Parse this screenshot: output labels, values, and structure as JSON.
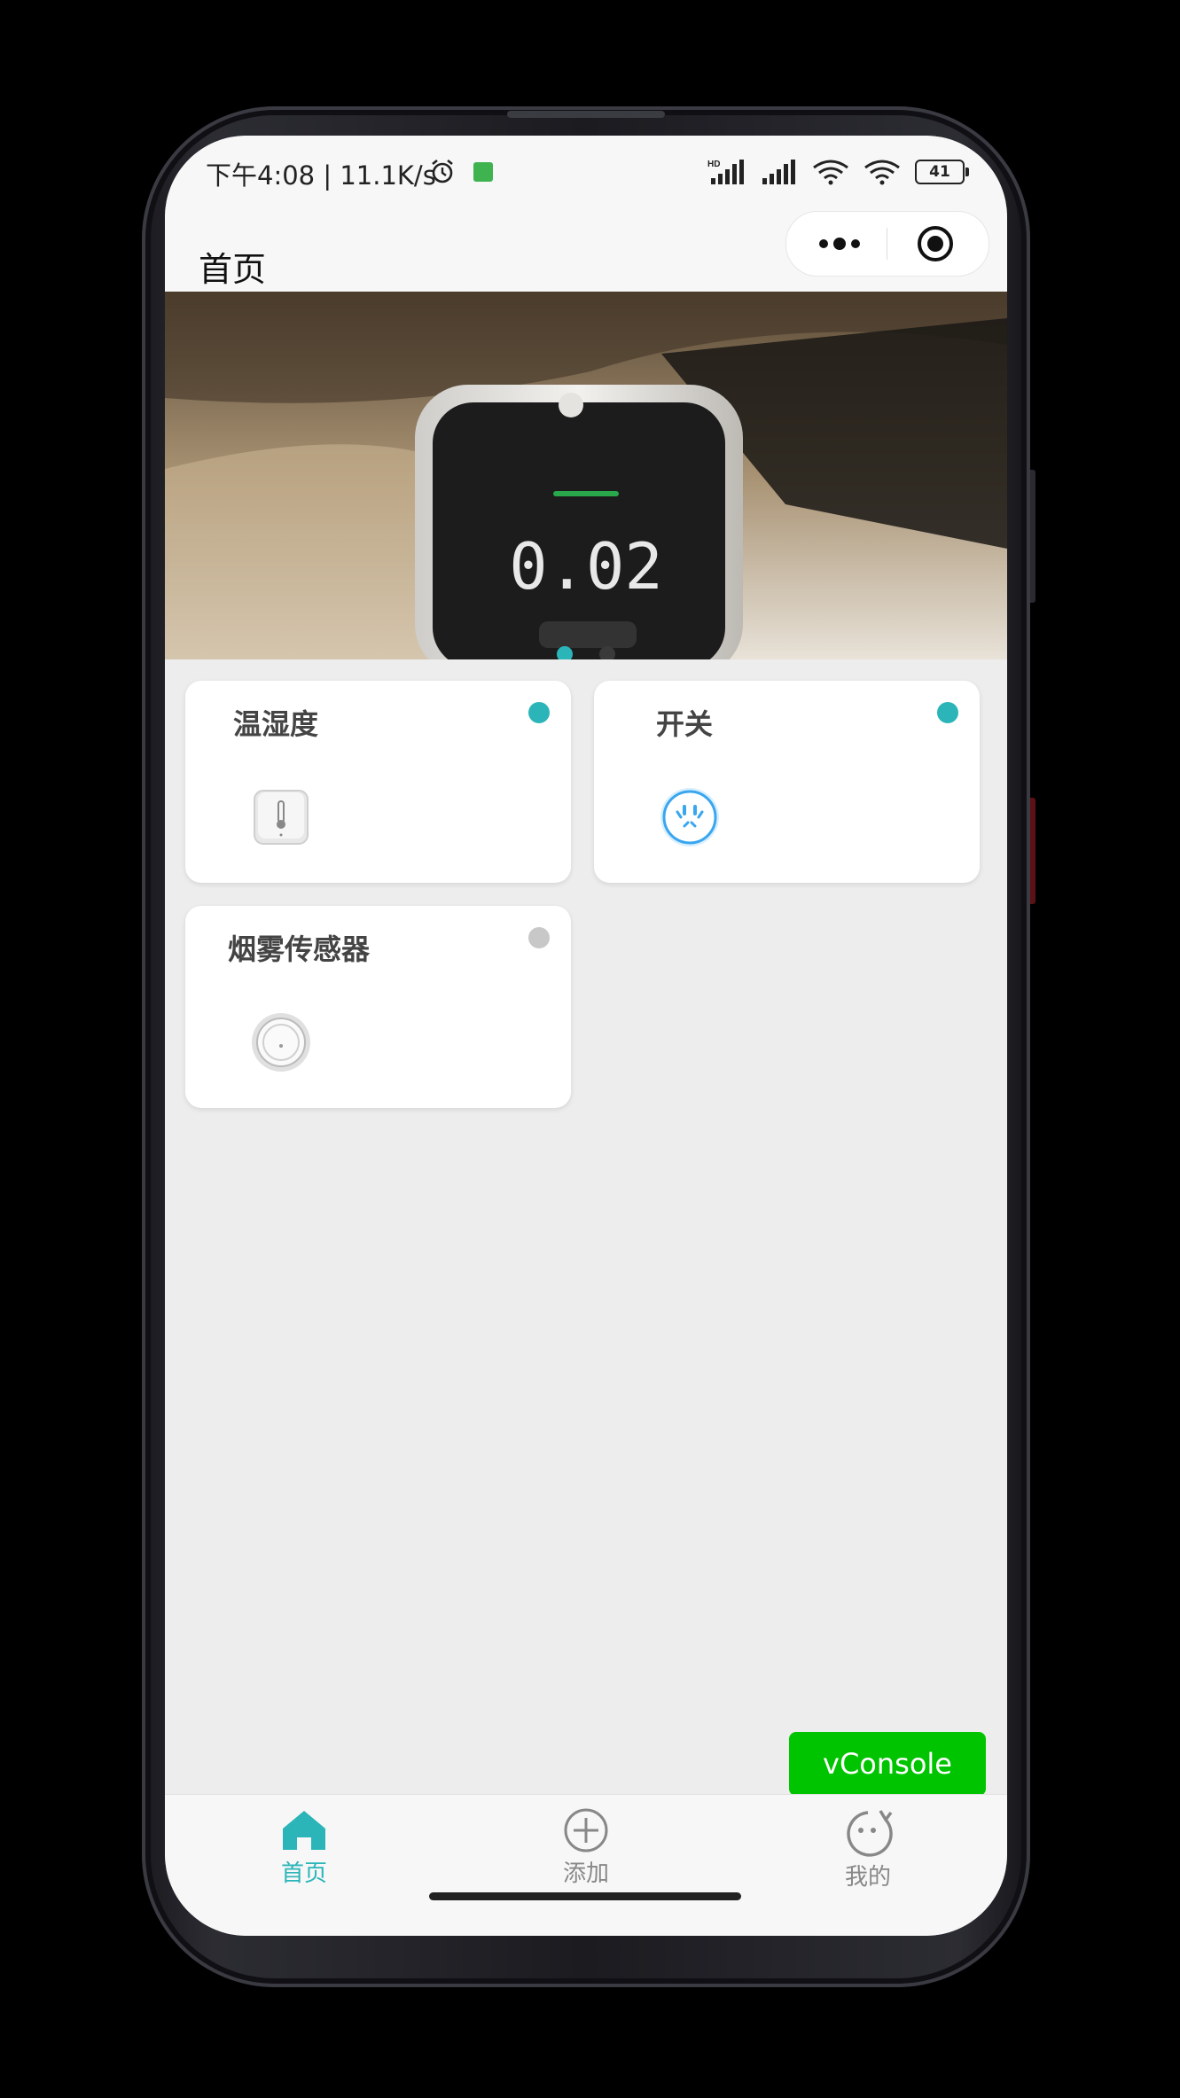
{
  "status_bar": {
    "time_speed": "下午4:08 | 11.1K/s",
    "network_label": "HD",
    "battery": "41"
  },
  "navbar": {
    "title": "首页"
  },
  "banner": {
    "display_reading": "0.02",
    "slide_count": 2,
    "active_slide": 0
  },
  "devices": [
    {
      "name": "温湿度",
      "online": true,
      "icon": "thermometer-sensor-icon"
    },
    {
      "name": "开关",
      "online": true,
      "icon": "smart-plug-icon"
    },
    {
      "name": "烟雾传感器",
      "online": false,
      "icon": "smoke-detector-icon"
    }
  ],
  "colors": {
    "accent": "#2bb5b8",
    "offline": "#c8c8c8",
    "vconsole": "#00c400",
    "tab_inactive": "#888888"
  },
  "vconsole": {
    "label": "vConsole"
  },
  "tabbar": {
    "tabs": [
      {
        "label": "首页",
        "icon": "home-icon",
        "active": true
      },
      {
        "label": "添加",
        "icon": "add-circle-icon",
        "active": false
      },
      {
        "label": "我的",
        "icon": "profile-face-icon",
        "active": false
      }
    ]
  }
}
